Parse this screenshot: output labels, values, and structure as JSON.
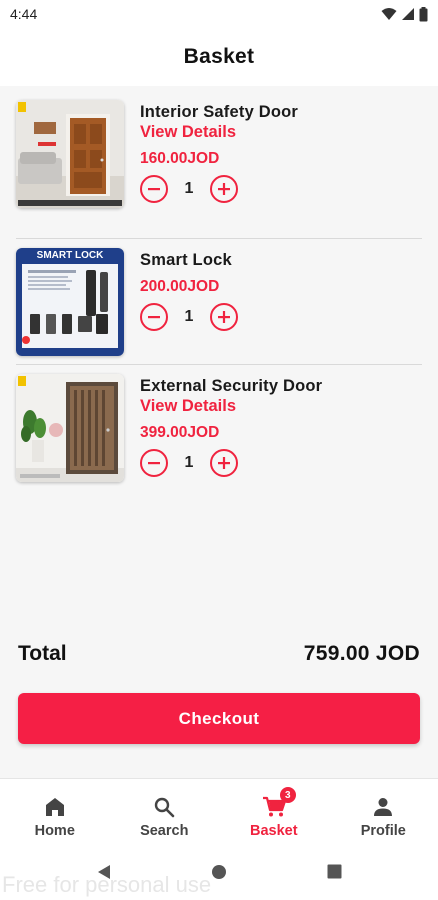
{
  "status_bar": {
    "time": "4:44"
  },
  "header": {
    "title": "Basket"
  },
  "items": [
    {
      "name": "Interior Safety Door",
      "details_label": "View Details",
      "price": "160.00JOD",
      "quantity": "1"
    },
    {
      "name": "Smart Lock",
      "price": "200.00JOD",
      "quantity": "1",
      "image_text": "SMART LOCK"
    },
    {
      "name": "External Security Door",
      "details_label": "View Details",
      "price": "399.00JOD",
      "quantity": "1"
    }
  ],
  "summary": {
    "total_label": "Total",
    "total_value": "759.00 JOD"
  },
  "checkout": {
    "label": "Checkout"
  },
  "bottom_nav": {
    "items": [
      {
        "label": "Home",
        "icon": "home-icon"
      },
      {
        "label": "Search",
        "icon": "search-icon"
      },
      {
        "label": "Basket",
        "icon": "cart-icon",
        "badge": "3",
        "active": true
      },
      {
        "label": "Profile",
        "icon": "person-icon"
      }
    ]
  },
  "watermark": "Free for personal use",
  "colors": {
    "accent": "#f0233f",
    "checkout": "#f51f45",
    "background": "#f6f6f6"
  }
}
